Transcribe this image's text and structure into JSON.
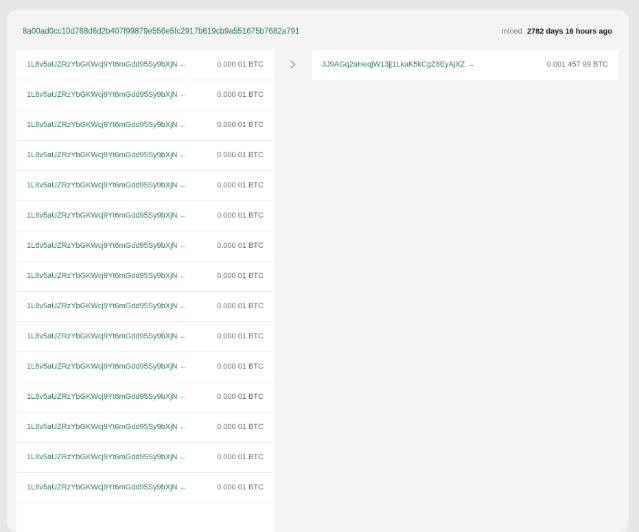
{
  "transaction": {
    "hash": "8a00ad0cc10d768d6d2b407f99879e556e5fc2917b619cb9a551675b7682a791",
    "mined_label": "mined",
    "mined_age": "2782 days 16 hours ago"
  },
  "inputs": [
    {
      "address": "1L8v5aUZRzYbGKWcj9Yt6mGdd95Sy9bXjN",
      "arrow": "←",
      "amount": "0.000 01 BTC"
    },
    {
      "address": "1L8v5aUZRzYbGKWcj9Yt6mGdd95Sy9bXjN",
      "arrow": "←",
      "amount": "0.000 01 BTC"
    },
    {
      "address": "1L8v5aUZRzYbGKWcj9Yt6mGdd95Sy9bXjN",
      "arrow": "←",
      "amount": "0.000 01 BTC"
    },
    {
      "address": "1L8v5aUZRzYbGKWcj9Yt6mGdd95Sy9bXjN",
      "arrow": "←",
      "amount": "0.000 01 BTC"
    },
    {
      "address": "1L8v5aUZRzYbGKWcj9Yt6mGdd95Sy9bXjN",
      "arrow": "←",
      "amount": "0.000 01 BTC"
    },
    {
      "address": "1L8v5aUZRzYbGKWcj9Yt6mGdd95Sy9bXjN",
      "arrow": "←",
      "amount": "0.000 01 BTC"
    },
    {
      "address": "1L8v5aUZRzYbGKWcj9Yt6mGdd95Sy9bXjN",
      "arrow": "←",
      "amount": "0.000 01 BTC"
    },
    {
      "address": "1L8v5aUZRzYbGKWcj9Yt6mGdd95Sy9bXjN",
      "arrow": "←",
      "amount": "0.000 01 BTC"
    },
    {
      "address": "1L8v5aUZRzYbGKWcj9Yt6mGdd95Sy9bXjN",
      "arrow": "←",
      "amount": "0.000 01 BTC"
    },
    {
      "address": "1L8v5aUZRzYbGKWcj9Yt6mGdd95Sy9bXjN",
      "arrow": "←",
      "amount": "0.000 01 BTC"
    },
    {
      "address": "1L8v5aUZRzYbGKWcj9Yt6mGdd95Sy9bXjN",
      "arrow": "←",
      "amount": "0.000 01 BTC"
    },
    {
      "address": "1L8v5aUZRzYbGKWcj9Yt6mGdd95Sy9bXjN",
      "arrow": "←",
      "amount": "0.000 01 BTC"
    },
    {
      "address": "1L8v5aUZRzYbGKWcj9Yt6mGdd95Sy9bXjN",
      "arrow": "←",
      "amount": "0.000 01 BTC"
    },
    {
      "address": "1L8v5aUZRzYbGKWcj9Yt6mGdd95Sy9bXjN",
      "arrow": "←",
      "amount": "0.000 01 BTC"
    },
    {
      "address": "1L8v5aUZRzYbGKWcj9Yt6mGdd95Sy9bXjN",
      "arrow": "←",
      "amount": "0.000 01 BTC"
    }
  ],
  "outputs": [
    {
      "address": "3J9AGq2aHeqjW13jj1LkaK5kCgZ8EyAjXZ",
      "arrow": "→",
      "amount": "0.001 457 99 BTC"
    }
  ],
  "icons": {
    "flow_arrow": "chevron-right-icon"
  },
  "colors": {
    "address": "#2f7a54",
    "spent_arrow": "#d9534f",
    "card_bg": "#f4f4f4",
    "page_bg": "#e6e6e6"
  }
}
